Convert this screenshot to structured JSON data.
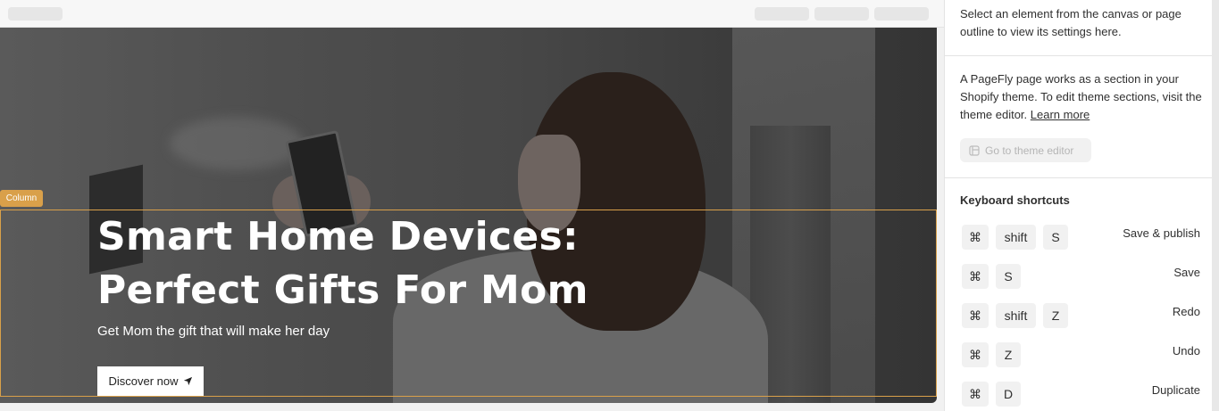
{
  "hero": {
    "tag": "Column",
    "headline_line1": "Smart Home Devices:",
    "headline_line2": "Perfect Gifts For Mom",
    "subheadline": "Get Mom the gift that will make her day",
    "cta_label": "Discover now"
  },
  "panel": {
    "intro": "Select an element from the canvas or page outline to view its settings here.",
    "info_text": "A PageFly page works as a section in your Shopify theme. To edit theme sections, visit the theme editor.",
    "learn_more": "Learn more",
    "theme_button": "Go to theme editor",
    "shortcuts_title": "Keyboard shortcuts",
    "shortcuts": [
      {
        "keys": [
          "⌘",
          "shift",
          "S"
        ],
        "label": "Save & publish"
      },
      {
        "keys": [
          "⌘",
          "S"
        ],
        "label": "Save"
      },
      {
        "keys": [
          "⌘",
          "shift",
          "Z"
        ],
        "label": "Redo"
      },
      {
        "keys": [
          "⌘",
          "Z"
        ],
        "label": "Undo"
      },
      {
        "keys": [
          "⌘",
          "D"
        ],
        "label": "Duplicate"
      }
    ]
  },
  "colors": {
    "accent_outline": "#d9a04a",
    "panel_bg": "#ffffff",
    "key_bg": "#f1f1f1"
  }
}
